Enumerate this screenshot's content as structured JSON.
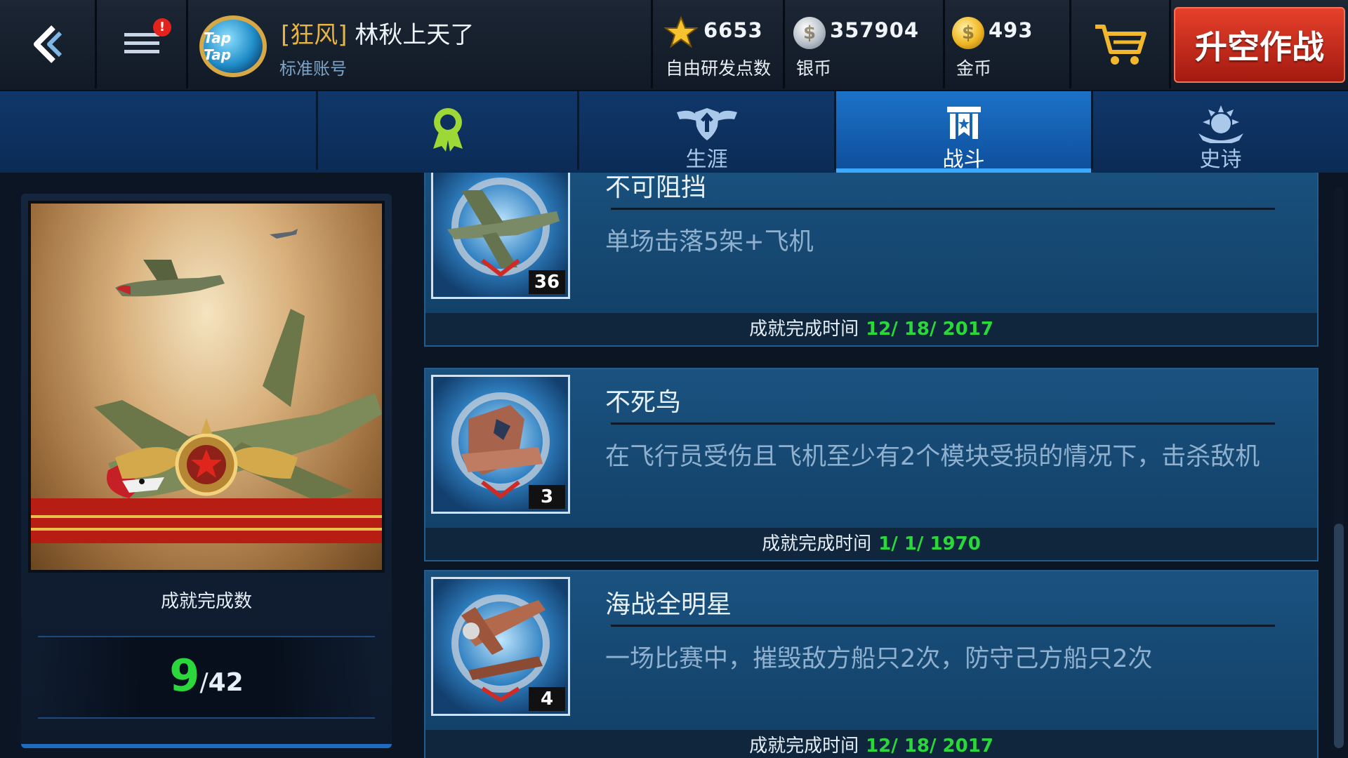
{
  "topbar": {
    "notification_badge": "!",
    "player": {
      "avatar_text": "Tap Tap",
      "clan_tag": "[狂风]",
      "name": "林秋上天了",
      "account_type": "标准账号"
    },
    "resources": {
      "research": {
        "value": "6653",
        "label": "自由研发点数"
      },
      "silver": {
        "value": "357904",
        "label": "银币"
      },
      "gold": {
        "value": "493",
        "label": "金币"
      }
    },
    "launch_button": "升空作战"
  },
  "tabs": [
    {
      "label": "",
      "icon": "medal-icon"
    },
    {
      "label": "生涯",
      "icon": "shield-wings-icon"
    },
    {
      "label": "战斗",
      "icon": "banner-icon",
      "active": true
    },
    {
      "label": "史诗",
      "icon": "laurel-star-icon"
    }
  ],
  "summary": {
    "label": "成就完成数",
    "completed": "9",
    "separator": "/",
    "total": "42"
  },
  "achievements": [
    {
      "title": "不可阻挡",
      "description": "单场击落5架+飞机",
      "count": "36",
      "date_label": "成就完成时间",
      "date": "12/ 18/ 2017",
      "icon": "fighter-plane-badge-icon"
    },
    {
      "title": "不死鸟",
      "description": "在飞行员受伤且飞机至少有2个模块受损的情况下，击杀敌机",
      "count": "3",
      "date_label": "成就完成时间",
      "date": "1/ 1/ 1970",
      "icon": "damaged-plane-badge-icon"
    },
    {
      "title": "海战全明星",
      "description": "一场比赛中，摧毁敌方船只2次，防守己方船只2次",
      "count": "4",
      "date_label": "成就完成时间",
      "date": "12/ 18/ 2017",
      "icon": "torpedo-bomber-badge-icon"
    }
  ],
  "colors": {
    "accent_blue": "#1c72c8",
    "launch_red": "#e6402b",
    "success_green": "#2bd83c",
    "clan_gold": "#e7b441"
  }
}
